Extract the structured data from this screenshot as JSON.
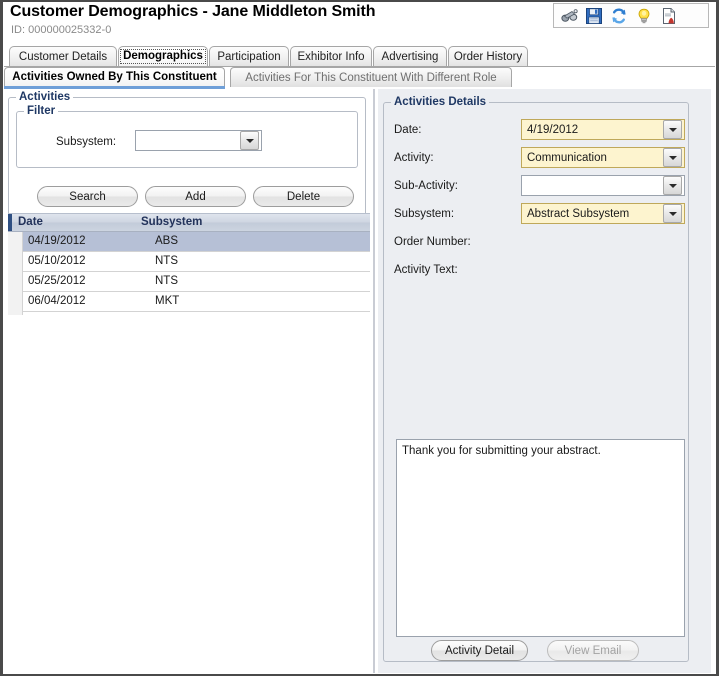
{
  "header": {
    "title": "Customer Demographics - Jane Middleton Smith",
    "subtitle": "ID: 000000025332-0"
  },
  "toolbar": {
    "buttons": [
      {
        "name": "binoculars-icon",
        "label": "Find"
      },
      {
        "name": "save-icon",
        "label": "Save"
      },
      {
        "name": "refresh-icon",
        "label": "Refresh"
      },
      {
        "name": "lightbulb-icon",
        "label": "Tips"
      },
      {
        "name": "report-icon",
        "label": "Report"
      }
    ]
  },
  "tabs": [
    {
      "label": "Customer Details",
      "selected": false
    },
    {
      "label": "Demographics",
      "selected": true
    },
    {
      "label": "Participation",
      "selected": false
    },
    {
      "label": "Exhibitor Info",
      "selected": false
    },
    {
      "label": "Advertising",
      "selected": false
    },
    {
      "label": "Order History",
      "selected": false
    }
  ],
  "subtabs": [
    {
      "label": "Activities Owned By This Constituent",
      "selected": true
    },
    {
      "label": "Activities For This Constituent With Different Role",
      "selected": false
    }
  ],
  "left": {
    "activities_group_title": "Activities",
    "filter_group_title": "Filter",
    "subsystem_label": "Subsystem:",
    "subsystem_value": "",
    "buttons": {
      "search": "Search",
      "add": "Add",
      "delete": "Delete"
    },
    "grid": {
      "columns": [
        "Date",
        "Subsystem"
      ],
      "rows": [
        {
          "date": "04/19/2012",
          "subsystem": "ABS",
          "selected": true
        },
        {
          "date": "05/10/2012",
          "subsystem": "NTS",
          "selected": false
        },
        {
          "date": "05/25/2012",
          "subsystem": "NTS",
          "selected": false
        },
        {
          "date": "06/04/2012",
          "subsystem": "MKT",
          "selected": false
        }
      ]
    }
  },
  "right": {
    "group_title": "Activities Details",
    "fields": [
      {
        "label": "Date:",
        "value": "4/19/2012",
        "filled": true
      },
      {
        "label": "Activity:",
        "value": "Communication",
        "filled": true
      },
      {
        "label": "Sub-Activity:",
        "value": "",
        "filled": false
      },
      {
        "label": "Subsystem:",
        "value": "Abstract Subsystem",
        "filled": true
      }
    ],
    "order_number_label": "Order Number:",
    "order_number_value": "",
    "activity_text_label": "Activity Text:",
    "activity_text_value": "Thank you for submitting your abstract.",
    "buttons": {
      "activity_detail": "Activity Detail",
      "view_email": "View Email"
    }
  },
  "colors": {
    "accent_blue": "#6f9fd8",
    "group_title": "#1f3864",
    "filled_field_bg": "#fdf4cf",
    "filled_field_border": "#bfa85a",
    "grid_selected_row": "#b6c0d6",
    "grid_header_accent": "#2f4f82",
    "right_pane_bg": "#eceef2"
  }
}
